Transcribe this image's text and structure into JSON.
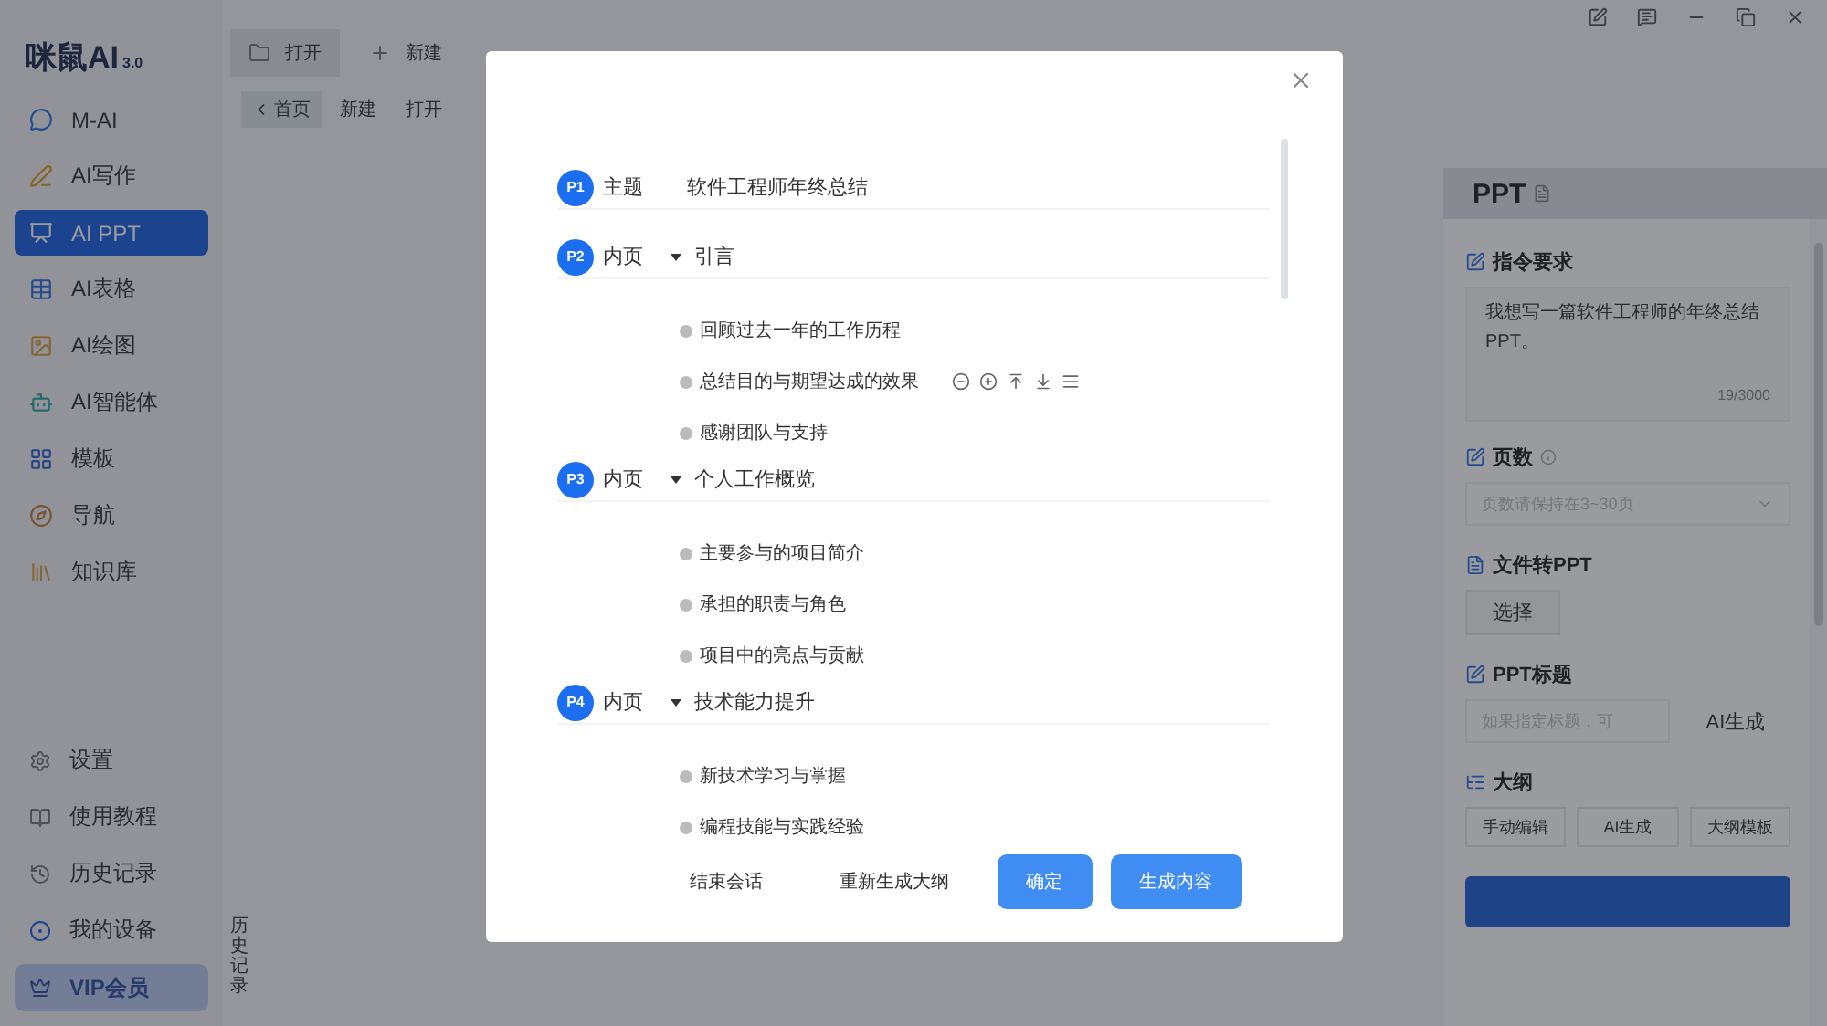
{
  "app": {
    "logo": "咪鼠AI",
    "version": "3.0"
  },
  "sidebar": {
    "items": [
      {
        "label": "M-AI",
        "selected": false,
        "kind": "chat"
      },
      {
        "label": "AI写作",
        "selected": false,
        "kind": "write"
      },
      {
        "label": "AI PPT",
        "selected": true,
        "kind": "slides"
      },
      {
        "label": "AI表格",
        "selected": false,
        "kind": "table"
      },
      {
        "label": "AI绘图",
        "selected": false,
        "kind": "image"
      },
      {
        "label": "AI智能体",
        "selected": false,
        "kind": "bot"
      },
      {
        "label": "模板",
        "selected": false,
        "kind": "template"
      },
      {
        "label": "导航",
        "selected": false,
        "kind": "compass"
      },
      {
        "label": "知识库",
        "selected": false,
        "kind": "book"
      }
    ],
    "bottom_items": [
      {
        "label": "设置",
        "kind": "gear"
      },
      {
        "label": "使用教程",
        "kind": "book"
      },
      {
        "label": "历史记录",
        "kind": "history"
      },
      {
        "label": "我的设备",
        "kind": "device"
      }
    ],
    "vip": "VIP会员"
  },
  "tabs": [
    {
      "label": "打开",
      "kind": "folder",
      "selected": true
    },
    {
      "label": "新建",
      "kind": "plus",
      "selected": false
    }
  ],
  "breadcrumb": [
    {
      "label": "首页",
      "kind": "back"
    },
    {
      "label": "新建",
      "kind": "plain"
    },
    {
      "label": "打开",
      "kind": "plain"
    }
  ],
  "history_tab": "历史记录",
  "right_panel": {
    "title": "PPT",
    "instruction": {
      "label": "指令要求",
      "value": "我想写一篇软件工程师的年终总结PPT。",
      "count": "19/3000"
    },
    "pages": {
      "label": "页数",
      "placeholder": "页数请保持在3~30页"
    },
    "file": {
      "label": "文件转PPT",
      "button": "选择"
    },
    "ppt_title": {
      "label": "PPT标题",
      "placeholder": "如果指定标题，可",
      "button": "AI生成"
    },
    "outline": {
      "label": "大纲",
      "buttons": [
        "手动编辑",
        "AI生成",
        "大纲模板"
      ]
    }
  },
  "dialog": {
    "items": [
      {
        "badge": "P1",
        "kind": "topic",
        "label": "主题",
        "title": "软件工程师年终总结"
      },
      {
        "badge": "P2",
        "kind": "page",
        "label": "内页",
        "title": "引言",
        "expanded": true,
        "points": [
          {
            "text": "回顾过去一年的工作历程",
            "actions_visible": false
          },
          {
            "text": "总结目的与期望达成的效果",
            "actions_visible": true
          },
          {
            "text": "感谢团队与支持",
            "actions_visible": false
          }
        ]
      },
      {
        "badge": "P3",
        "kind": "page",
        "label": "内页",
        "title": "个人工作概览",
        "expanded": true,
        "points": [
          {
            "text": "主要参与的项目简介",
            "actions_visible": false
          },
          {
            "text": "承担的职责与角色",
            "actions_visible": false
          },
          {
            "text": "项目中的亮点与贡献",
            "actions_visible": false
          }
        ]
      },
      {
        "badge": "P4",
        "kind": "page",
        "label": "内页",
        "title": "技术能力提升",
        "expanded": true,
        "points": [
          {
            "text": "新技术学习与掌握",
            "actions_visible": false
          },
          {
            "text": "编程技能与实践经验",
            "actions_visible": false
          }
        ]
      }
    ],
    "buttons": [
      {
        "label": "结束会话",
        "kind": "text"
      },
      {
        "label": "重新生成大纲",
        "kind": "text"
      },
      {
        "label": "确定",
        "kind": "primary"
      },
      {
        "label": "生成内容",
        "kind": "primary"
      }
    ]
  }
}
